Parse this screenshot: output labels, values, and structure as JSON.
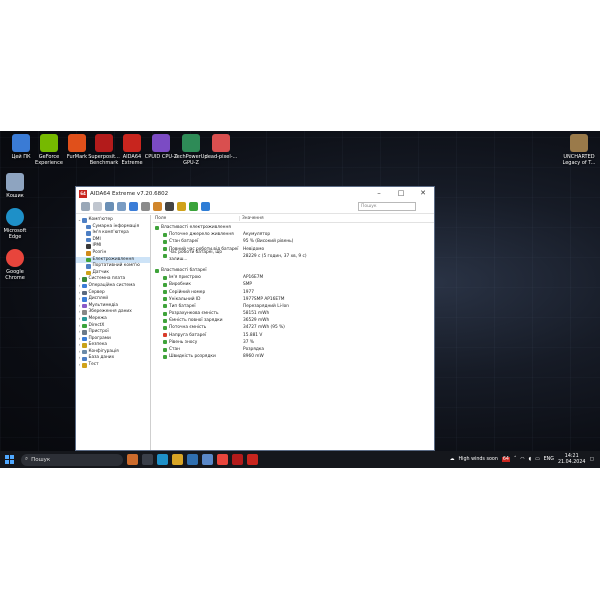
{
  "desktop": {
    "icons_left": [
      {
        "label": "Цей ПК",
        "color": "#3a7bd5"
      },
      {
        "label": "GeForce Experience",
        "color": "#76b900"
      },
      {
        "label": "FurMark",
        "color": "#e0501b"
      },
      {
        "label": "Superposit... Benchmark",
        "color": "#b31b1b"
      },
      {
        "label": "AIDA64 Extreme",
        "color": "#c8251e"
      },
      {
        "label": "CPUID CPU-Z",
        "color": "#7b4bc4"
      },
      {
        "label": "TechPowerUp GPU-Z",
        "color": "#2e8b57"
      },
      {
        "label": "dead-pixel-...",
        "color": "#d94f4f"
      }
    ],
    "icons_col": [
      {
        "label": "Кошик",
        "color": "#8ea4c0"
      },
      {
        "label": "Microsoft Edge",
        "color": "#1e90c8"
      },
      {
        "label": "Google Chrome",
        "color": "#e8453c"
      }
    ],
    "icon_right": {
      "label": "UNCHARTED Legacy of T...",
      "color": "#9a7a4a"
    }
  },
  "window": {
    "title": "AIDA64 Extreme v7.20.6802",
    "controls": {
      "minimize": "–",
      "maximize": "□",
      "close": "✕"
    },
    "search_placeholder": "Пошук",
    "toolbar_colors": [
      "#9aa8b8",
      "#c0c6cf",
      "#6a8fb5",
      "#7a9cc3",
      "#3b7dd8",
      "#8b8b8b",
      "#d1862b",
      "#444444",
      "#d0a21a",
      "#3aa33a",
      "#2e7dd6"
    ]
  },
  "tree": [
    {
      "label": "Комп'ютер",
      "level": 0,
      "exp": "⌄",
      "color": "#4d7fc4"
    },
    {
      "label": "Сумарна інформація",
      "level": 1,
      "color": "#4d7fc4"
    },
    {
      "label": "Ім'я комп'ютера",
      "level": 1,
      "color": "#4d7fc4"
    },
    {
      "label": "DMI",
      "level": 1,
      "color": "#4d7fc4"
    },
    {
      "label": "IPMI",
      "level": 1,
      "color": "#3a3a3a"
    },
    {
      "label": "Розгін",
      "level": 1,
      "color": "#d08a1a"
    },
    {
      "label": "Електроживлення",
      "level": 1,
      "color": "#3fa33a",
      "selected": true
    },
    {
      "label": "Портативний комп'ю",
      "level": 1,
      "color": "#4d7fc4"
    },
    {
      "label": "Датчик",
      "level": 1,
      "color": "#d0a21a"
    },
    {
      "label": "Системна плата",
      "level": 0,
      "exp": "›",
      "color": "#3a8a3a"
    },
    {
      "label": "Операційна система",
      "level": 0,
      "exp": "›",
      "color": "#3b7dd8"
    },
    {
      "label": "Сервер",
      "level": 0,
      "exp": "›",
      "color": "#5a6a80"
    },
    {
      "label": "Дисплей",
      "level": 0,
      "exp": "›",
      "color": "#3b7dd8"
    },
    {
      "label": "Мультимедіа",
      "level": 0,
      "exp": "›",
      "color": "#8a5ac8"
    },
    {
      "label": "Збереження даних",
      "level": 0,
      "exp": "›",
      "color": "#888888"
    },
    {
      "label": "Мережа",
      "level": 0,
      "exp": "›",
      "color": "#2a9a9a"
    },
    {
      "label": "DirectX",
      "level": 0,
      "exp": "›",
      "color": "#3aa33a"
    },
    {
      "label": "Пристрої",
      "level": 0,
      "exp": "›",
      "color": "#6a7a8a"
    },
    {
      "label": "Програми",
      "level": 0,
      "exp": "›",
      "color": "#3b7dd8"
    },
    {
      "label": "Безпека",
      "level": 0,
      "exp": "›",
      "color": "#c8a21a"
    },
    {
      "label": "Конфігурація",
      "level": 0,
      "exp": "›",
      "color": "#6a8aa8"
    },
    {
      "label": "База даних",
      "level": 0,
      "exp": "›",
      "color": "#4d7fc4"
    },
    {
      "label": "Тест",
      "level": 0,
      "exp": "›",
      "color": "#d0a21a"
    }
  ],
  "details": {
    "col_field": "Поле",
    "col_value": "Значення",
    "sections": [
      {
        "title": "Властивості електроживлення",
        "rows": [
          {
            "k": "Поточне джерело живлення",
            "v": "Акумулятор"
          },
          {
            "k": "Стан батареї",
            "v": "95 % (Високий рівень)"
          },
          {
            "k": "Повний час роботи від батареї",
            "v": "Невідомо"
          },
          {
            "k": "Час роботи батареї, що залиш...",
            "v": "28229 с (5 годин, 37 хв, 9 с)"
          }
        ]
      },
      {
        "title": "Властивості батареї",
        "rows": [
          {
            "k": "Ім'я пристрою",
            "v": "AP16E7M"
          },
          {
            "k": "Виробник",
            "v": "SMP"
          },
          {
            "k": "Серійний номер",
            "v": "1977"
          },
          {
            "k": "Унікальний ID",
            "v": "1977SMP AP16E7M"
          },
          {
            "k": "Тип батареї",
            "v": "Перезарядний Li-Ion"
          },
          {
            "k": "Розрахункова ємність",
            "v": "58151 mWh"
          },
          {
            "k": "Ємність повної зарядки",
            "v": "36529 mWh"
          },
          {
            "k": "Поточна ємність",
            "v": "34727 mWh (95 %)"
          },
          {
            "k": "Напруга батареї",
            "v": "15.881 V",
            "alert": true
          },
          {
            "k": "Рівень зносу",
            "v": "37 %"
          },
          {
            "k": "Стан",
            "v": "Розрядка"
          },
          {
            "k": "Швидкість розрядки",
            "v": "8960 mW"
          }
        ]
      }
    ]
  },
  "taskbar": {
    "search": "Пошук",
    "apps": [
      "#cc6b2c",
      "#3a3f49",
      "#1e90c8",
      "#d8a526",
      "#2f6fb0",
      "#5a88c8",
      "#e8453c",
      "#b31b1b",
      "#c8251e"
    ],
    "weather": "High winds soon",
    "lang": "ENG",
    "time": "14:21",
    "date": "21.04.2024",
    "tray_badge": "64"
  }
}
